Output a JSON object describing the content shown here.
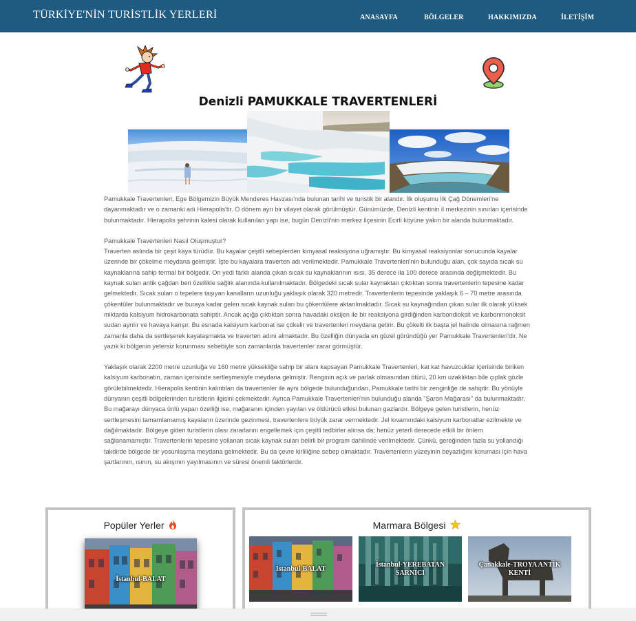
{
  "header": {
    "brand": "TÜRKİYE'NİN TURİSTLİK YERLERİ",
    "nav": [
      "ANASAYFA",
      "BÖLGELER",
      "HAKKIMIZDA",
      "İLETİŞİM"
    ],
    "bg_color": "#1f5a80"
  },
  "decorations": {
    "left": "running-boy-illustration",
    "right": "map-pin-icon"
  },
  "article": {
    "title": "Denizli PAMUKKALE TRAVERTENLERİ",
    "images": [
      "pamukkale-woman-on-travertines",
      "pamukkale-turquoise-pools",
      "pamukkale-terraces-under-sky"
    ],
    "paragraphs": [
      "Pamukkale Travertenleri, Ege Bölgemizin Büyük Menderes Havzası'nda bulunan tarihi ve turistik bir alandır. İlk oluşumu İlk Çağ Dönemleri'ne dayanmaktadır ve o zamanki adı Hierapolis'tir. O dönem ayrı bir vilayet olarak görülmüştür. Günümüzde, Denizli kentinin il merkezinin sınırları içerisinde bulunmaktadır. Hierapolis şehrinin kalesi olarak kullanılan yapı ise, bugün Denizli'nin merkez ilçesinin Ecirli köyüne yakın bir alanda bulunmaktadır.",
      "Pamukkale Travertenleri Nasıl Oluşmuştur?",
      "Traverten aslında bir çeşit kaya türüdür. Bu kayalar çeşitli sebeplerden kimyasal reaksiyona uğramıştır. Bu kimyasal reaksiyonlar sonucunda kayalar üzerinde bir çökelme meydana gelmiştir. İşte bu kayalara traverten adı verilmektedir. Pamukkale Travertenleri'nin bulunduğu alan, çok sayıda sıcak su kaynaklarına sahip termal bir bölgedir. On yedi farklı alanda çıkan sıcak su kaynaklarının ısısı, 35 derece ila 100 derece arasında değişmektedir. Bu kaynak suları antik çağdan beri özellikle sağlık alanında kullanılmaktadır. Bölgedeki sıcak sular kaynaktan çıktıktan sonra travertenlerin tepesine kadar gelmektedir. Sıcak suları o tepelere taşıyan kanalların uzunluğu yaklaşık olarak 320 metredir. Travertenlerin tepesinde yaklaşık 6 – 70 metre arasında çökentüler bulunmaktadır ve buraya kadar gelen sıcak kaynak suları bu çökentülere aktarılmaktadır. Sıcak su kaynağından çıkan sular ilk olarak yüksek miktarda kalsiyum hidrokarbonata sahiptir. Ancak açığa çıktıktan sonra havadaki oksijen ile bir reaksiyona girdiğinden karbondioksit ve karbonmonoksit sudan ayrılır ve havaya karışır. Bu esnada kalsiyum karbonat ise çökelir ve travertenleri meydana getirir. Bu çökelti ilk başta jel halinde olmasına rağmen zamanla daha da sertleşerek kayalaşmakta ve traverten adını almaktadır. Bu özelliğin dünyada en güzel göründüğü yer Pamukkale Travertenleri'dir. Ne yazık ki bölgenin yetersiz korunması sebebiyle son zamanlarda travertenler zarar görmüştür.",
      "Yaklaşık olarak 2200 metre uzunluğa ve 160 metre yüksekliğe sahip bir alanı kapsayan Pamukkale Travertenleri, kat kat havuzcuklar içerisinde biriken kalsiyum karbonatın, zaman içerisinde sertleşmesiyle meydana gelmiştir. Renginin açık ve parlak olmasından ötürü, 20 km uzaklıktan bile çıplak gözle görülebilmektedir. Hierapolis kentinin kalıntıları da travertenler ile aynı bölgede bulunduğundan, Pamukkale tarihi bir zenginliğe de sahiptir. Bu yönüyle dünyanın çeşitli bölgelerinden turistlerin ilgisini çekmektedir. Ayrıca Pamukkale Travertenleri'nin bulunduğu alanda \"Şaron Mağarası\" da bulunmaktadır. Bu mağarayı dünyaca ünlü yapan özelliği ise, mağaranın içinden yayılan ve öldürücü etkisi bulunan gazlardır. Bölgeye gelen turistlerin, henüz sertleşmesini tamamlamamış kayaların üzerinde gezinmesi, travertenlere büyük zarar vermektedir. Jel kıvamındaki kalsiyum karbonatlar ezilmekte ve dağılmaktadır. Bölgeye giden turistlerin olası zararlarını engellemek için çeşitli tedbirler alınsa da; henüz yeterli derecede etkili bir önlem sağlanamamıştır. Travertenlerin tepesine yollanan sıcak kaynak suları belirli bir program dahilinde verilmektedir. Çünkü, gereğinden fazla su yollandığı takdirde bölgede bir yosunlaşma meydana gelmektedir. Bu da çevre kirliliğine sebep olmaktadır. Travertenlerin yüzeyinin beyazlığını koruması için hava şartlarının, ısının, su akışının yayılmasının ve süresi önemli faktörlerdir."
    ]
  },
  "popular": {
    "title": "Popüler Yerler",
    "icon": "fire-icon",
    "items": [
      "İstanbul-BALAT"
    ]
  },
  "marmara": {
    "title": "Marmara Bölgesi",
    "icon": "star-icon",
    "items": [
      "İstanbul-BALAT",
      "İstanbul-YEREBATAN SARNICI",
      "Çanakkale-TROYA ANTİK KENTİ"
    ]
  }
}
